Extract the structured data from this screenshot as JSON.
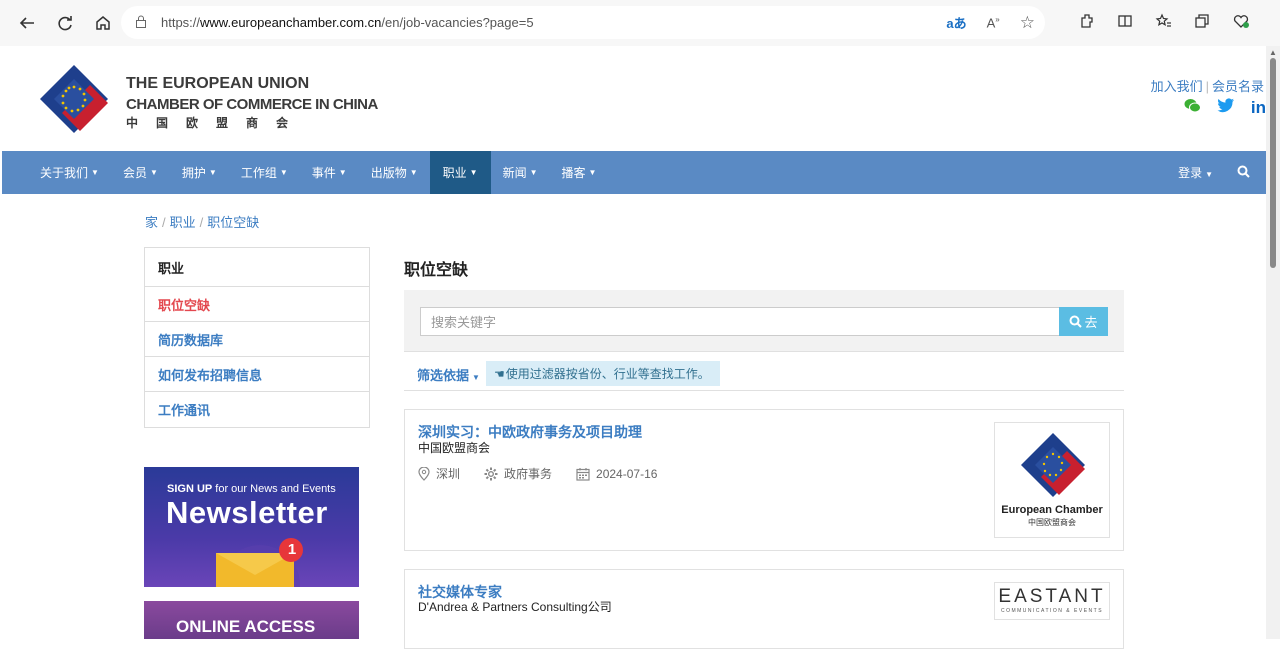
{
  "browser": {
    "url_prefix": "https://",
    "url_host": "www.europeanchamber.com.cn",
    "url_path": "/en/job-vacancies?page=5"
  },
  "header": {
    "logo_line1": "THE EUROPEAN UNION",
    "logo_line2": "CHAMBER OF COMMERCE IN CHINA",
    "logo_line3": "中国欧盟商会",
    "join_link": "加入我们",
    "directory_link": "会员名录"
  },
  "nav": {
    "items": [
      {
        "label": "关于我们"
      },
      {
        "label": "会员"
      },
      {
        "label": "拥护"
      },
      {
        "label": "工作组"
      },
      {
        "label": "事件"
      },
      {
        "label": "出版物"
      },
      {
        "label": "职业"
      },
      {
        "label": "新闻"
      },
      {
        "label": "播客"
      }
    ],
    "login": "登录"
  },
  "breadcrumb": [
    "家",
    "职业",
    "职位空缺"
  ],
  "sidebar": {
    "heading": "职业",
    "items": [
      {
        "label": "职位空缺"
      },
      {
        "label": "简历数据库"
      },
      {
        "label": "如何发布招聘信息"
      },
      {
        "label": "工作通讯"
      }
    ]
  },
  "banners": {
    "newsletter_signup": "SIGN UP",
    "newsletter_rest": " for our News and Events",
    "newsletter_title": "Newsletter",
    "newsletter_badge": "1",
    "online_access": "ONLINE ACCESS"
  },
  "main": {
    "title": "职位空缺",
    "search_placeholder": "搜索关键字",
    "search_button": "去",
    "filter_label": "筛选依据",
    "filter_hint": "使用过滤器按省份、行业等查找工作。"
  },
  "jobs": [
    {
      "title": "深圳实习：中欧政府事务及项目助理",
      "company": "中国欧盟商会",
      "location": "深圳",
      "sector": "政府事务",
      "date": "2024-07-16",
      "logo_text": "European Chamber",
      "logo_subtext": "中国欧盟商会"
    },
    {
      "title": "社交媒体专家",
      "company": "D'Andrea & Partners Consulting公司",
      "logo_text": "EASTANT",
      "logo_subtext": "COMMUNICATION & EVENTS"
    }
  ],
  "colors": {
    "nav_bg": "#5a8ac4",
    "nav_active": "#1f5a87",
    "link": "#3c7dc2",
    "current_red": "#e3474e"
  }
}
